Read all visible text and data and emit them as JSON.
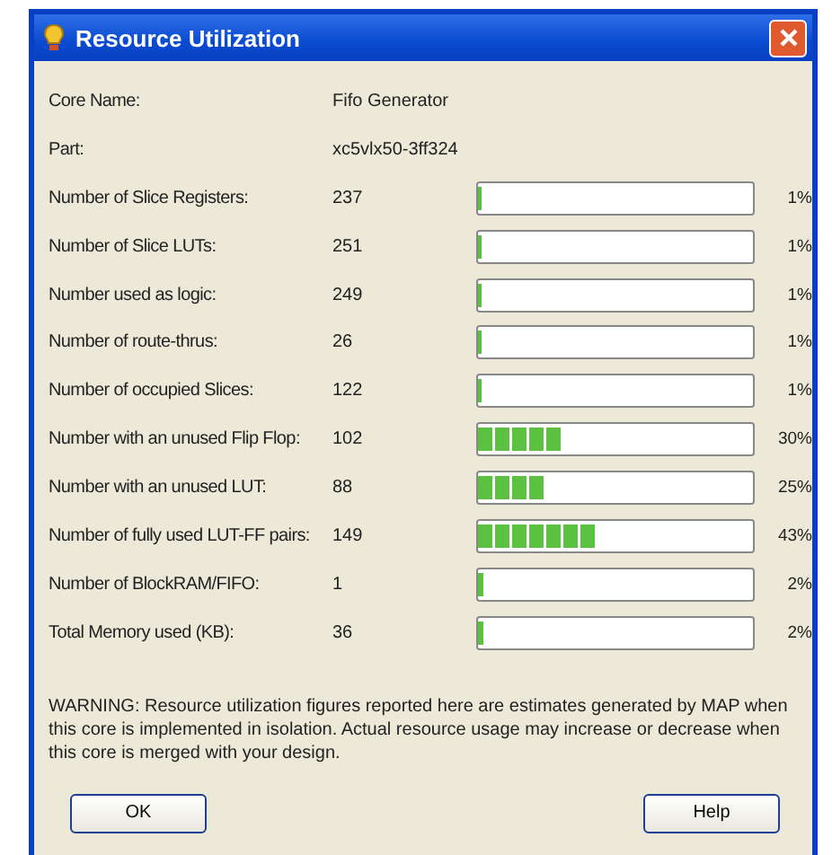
{
  "window": {
    "title": "Resource Utilization"
  },
  "info": [
    {
      "label": "Core Name:",
      "value": "Fifo Generator"
    },
    {
      "label": "Part:",
      "value": "xc5vlx50-3ff324"
    }
  ],
  "resources": [
    {
      "label": "Number of Slice Registers:",
      "value": "237",
      "level": 0.01,
      "percent": "1%"
    },
    {
      "label": "Number of Slice LUTs:",
      "value": "251",
      "level": 0.01,
      "percent": "1%"
    },
    {
      "label": "Number used as logic:",
      "value": "249",
      "level": 0.01,
      "percent": "1%"
    },
    {
      "label": "Number of route-thrus:",
      "value": "26",
      "level": 0.01,
      "percent": "1%"
    },
    {
      "label": "Number of occupied Slices:",
      "value": "122",
      "level": 0.01,
      "percent": "1%"
    },
    {
      "label": "Number with an unused Flip Flop:",
      "value": "102",
      "level": 0.3,
      "percent": "30%"
    },
    {
      "label": "Number with an unused LUT:",
      "value": "88",
      "level": 0.25,
      "percent": "25%"
    },
    {
      "label": "Number of fully used LUT-FF pairs:",
      "value": "149",
      "level": 0.43,
      "percent": "43%"
    },
    {
      "label": "Number of BlockRAM/FIFO:",
      "value": "1",
      "level": 0.02,
      "percent": "2%"
    },
    {
      "label": "Total Memory used (KB):",
      "value": "36",
      "level": 0.02,
      "percent": "2%"
    }
  ],
  "warning": "WARNING: Resource utilization figures reported here are estimates generated by MAP when this core is implemented in isolation.  Actual resource usage may increase or decrease when this core is merged with your design.",
  "buttons": [
    {
      "label": "OK"
    },
    {
      "label": "Help"
    }
  ]
}
